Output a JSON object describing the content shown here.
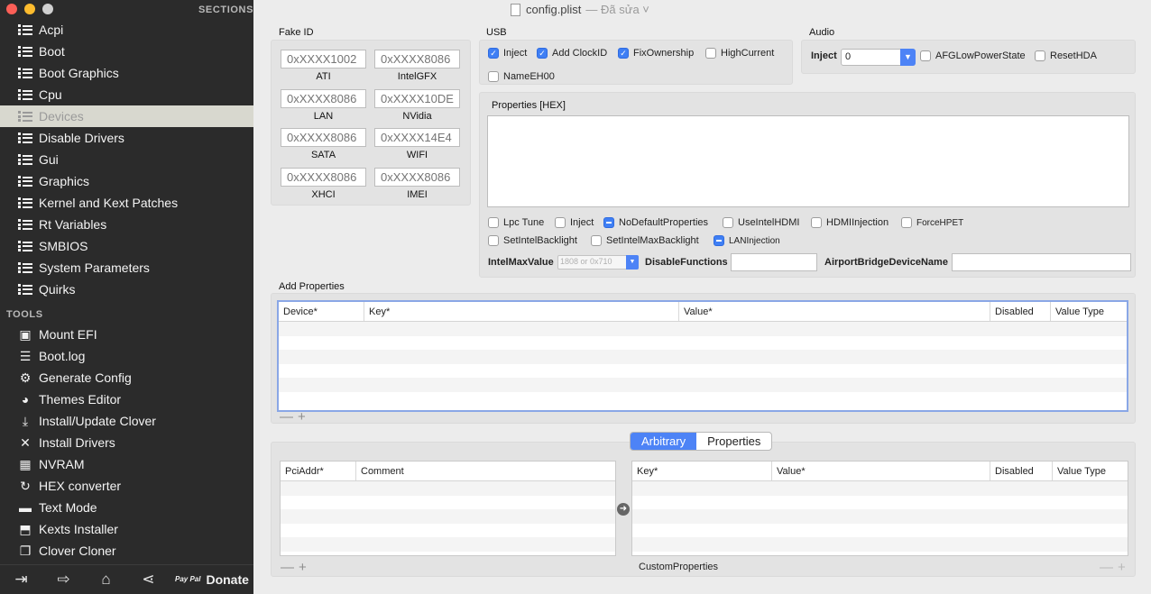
{
  "window": {
    "file_name": "config.plist",
    "file_status": "— Đã sửa ˅"
  },
  "sidebar": {
    "sections_header": "SECTIONS",
    "sections": [
      {
        "label": "Acpi"
      },
      {
        "label": "Boot"
      },
      {
        "label": "Boot Graphics"
      },
      {
        "label": "Cpu"
      },
      {
        "label": "Devices",
        "active": true
      },
      {
        "label": "Disable Drivers"
      },
      {
        "label": "Gui"
      },
      {
        "label": "Graphics"
      },
      {
        "label": "Kernel and Kext Patches"
      },
      {
        "label": "Rt Variables"
      },
      {
        "label": "SMBIOS"
      },
      {
        "label": "System Parameters"
      },
      {
        "label": "Quirks"
      }
    ],
    "tools_header": "TOOLS",
    "tools": [
      {
        "label": "Mount EFI",
        "icon": "mount-icon",
        "glyph": "▣"
      },
      {
        "label": "Boot.log",
        "icon": "log-icon",
        "glyph": "☰"
      },
      {
        "label": "Generate Config",
        "icon": "gear-icon",
        "glyph": "⚙"
      },
      {
        "label": "Themes Editor",
        "icon": "palette-icon",
        "glyph": "◕"
      },
      {
        "label": "Install/Update Clover",
        "icon": "download-icon",
        "glyph": "⤓"
      },
      {
        "label": "Install Drivers",
        "icon": "tools-icon",
        "glyph": "✕"
      },
      {
        "label": "NVRAM",
        "icon": "chip-icon",
        "glyph": "▦"
      },
      {
        "label": "HEX converter",
        "icon": "convert-icon",
        "glyph": "↻"
      },
      {
        "label": "Text Mode",
        "icon": "text-mode-icon",
        "glyph": "▬"
      },
      {
        "label": "Kexts Installer",
        "icon": "kext-icon",
        "glyph": "⬒"
      },
      {
        "label": "Clover Cloner",
        "icon": "clone-icon",
        "glyph": "❐"
      }
    ],
    "bottom": {
      "donate_label": "Donate",
      "paypal_text": "Pay Pal"
    }
  },
  "fake_id": {
    "title": "Fake ID",
    "fields": [
      {
        "placeholder": "0xXXXX1002",
        "label": "ATI"
      },
      {
        "placeholder": "0xXXXX8086",
        "label": "IntelGFX"
      },
      {
        "placeholder": "0xXXXX8086",
        "label": "LAN"
      },
      {
        "placeholder": "0xXXXX10DE",
        "label": "NVidia"
      },
      {
        "placeholder": "0xXXXX8086",
        "label": "SATA"
      },
      {
        "placeholder": "0xXXXX14E4",
        "label": "WIFI"
      },
      {
        "placeholder": "0xXXXX8086",
        "label": "XHCI"
      },
      {
        "placeholder": "0xXXXX8086",
        "label": "IMEI"
      }
    ]
  },
  "usb": {
    "title": "USB",
    "options": [
      {
        "label": "Inject",
        "state": "on"
      },
      {
        "label": "Add ClockID",
        "state": "on"
      },
      {
        "label": "FixOwnership",
        "state": "on"
      },
      {
        "label": "HighCurrent",
        "state": "off"
      },
      {
        "label": "NameEH00",
        "state": "off"
      }
    ]
  },
  "audio": {
    "title": "Audio",
    "inject_label": "Inject",
    "inject_value": "0",
    "options": [
      {
        "label": "AFGLowPowerState",
        "state": "off"
      },
      {
        "label": "ResetHDA",
        "state": "off"
      }
    ]
  },
  "properties_hex": {
    "title": "Properties [HEX]",
    "value": ""
  },
  "device_flags": [
    {
      "label": "Lpc Tune",
      "state": "off"
    },
    {
      "label": "Inject",
      "state": "off"
    },
    {
      "label": "NoDefaultProperties",
      "state": "mixed"
    },
    {
      "label": "UseIntelHDMI",
      "state": "off"
    },
    {
      "label": "HDMIInjection",
      "state": "off"
    },
    {
      "label": "ForceHPET",
      "state": "off"
    },
    {
      "label": "SetIntelBacklight",
      "state": "off"
    },
    {
      "label": "SetIntelMaxBacklight",
      "state": "off"
    },
    {
      "label": "LANInjection",
      "state": "mixed"
    }
  ],
  "misc_fields": {
    "intel_max_value_label": "IntelMaxValue",
    "intel_max_value_placeholder": "1808 or 0x710",
    "disable_functions_label": "DisableFunctions",
    "disable_functions_value": "",
    "airport_label": "AirportBridgeDeviceName",
    "airport_value": ""
  },
  "add_properties": {
    "title": "Add Properties",
    "columns": [
      "Device*",
      "Key*",
      "Value*",
      "Disabled",
      "Value Type"
    ]
  },
  "custom_properties": {
    "tabs": [
      {
        "label": "Arbitrary",
        "selected": true
      },
      {
        "label": "Properties",
        "selected": false
      }
    ],
    "left_columns": [
      "PciAddr*",
      "Comment"
    ],
    "right_columns": [
      "Key*",
      "Value*",
      "Disabled",
      "Value Type"
    ],
    "footer_label": "CustomProperties"
  },
  "colors": {
    "sidebar_bg": "#2b2b2b",
    "accent": "#3f7ff4",
    "close": "#fc5f57",
    "minimize": "#fdbc2e",
    "zoom_disabled": "#d0d0d0"
  }
}
